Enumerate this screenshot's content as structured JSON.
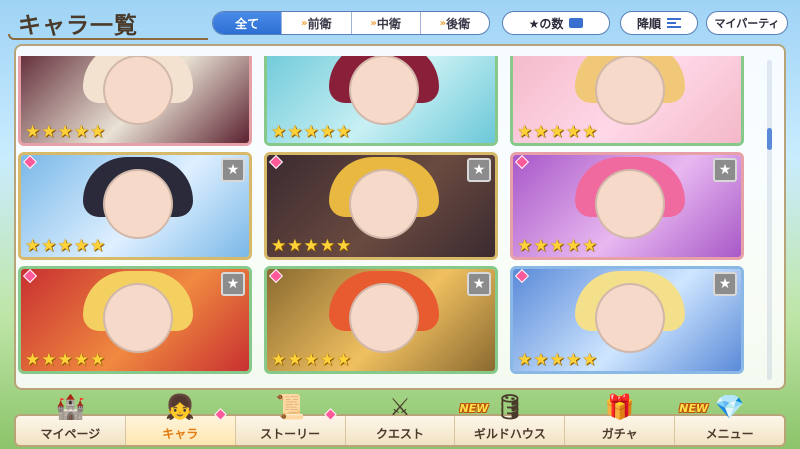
{
  "header": {
    "title": "キャラ一覧",
    "filters": [
      {
        "label": "全て",
        "active": true,
        "chevrons": ""
      },
      {
        "label": "前衛",
        "active": false,
        "chevrons": "»"
      },
      {
        "label": "中衛",
        "active": false,
        "chevrons": "»"
      },
      {
        "label": "後衛",
        "active": false,
        "chevrons": "»"
      }
    ],
    "sort_label": "★の数",
    "order_label": "降順",
    "party_label": "マイパーティ"
  },
  "cards": [
    {
      "stars": 5,
      "frame": "pink",
      "art": [
        "#5a2230",
        "#f3e2d0",
        "#e9e2d4"
      ],
      "rank": false,
      "new": false
    },
    {
      "stars": 5,
      "frame": "green",
      "art": [
        "#6bc8d8",
        "#8a1f3a",
        "#c8f0f4"
      ],
      "rank": false,
      "new": false
    },
    {
      "stars": 5,
      "frame": "green",
      "art": [
        "#f3b8c8",
        "#f0c878",
        "#ffd8e8"
      ],
      "rank": false,
      "new": false
    },
    {
      "stars": 5,
      "frame": "gold",
      "art": [
        "#7ab8e8",
        "#2a2a3a",
        "#dff0ff"
      ],
      "rank": true,
      "new": true
    },
    {
      "stars": 5,
      "frame": "gold",
      "art": [
        "#3a2a30",
        "#e8b840",
        "#6a4a40"
      ],
      "rank": true,
      "new": true
    },
    {
      "stars": 5,
      "frame": "pink",
      "art": [
        "#a858c8",
        "#f06aa0",
        "#e8b8f0"
      ],
      "rank": true,
      "new": true
    },
    {
      "stars": 5,
      "frame": "green",
      "art": [
        "#c83030",
        "#f4d060",
        "#f08a40"
      ],
      "rank": true,
      "new": true
    },
    {
      "stars": 5,
      "frame": "green",
      "art": [
        "#8a6a30",
        "#e85a30",
        "#f0c060"
      ],
      "rank": true,
      "new": true
    },
    {
      "stars": 5,
      "frame": "blue",
      "art": [
        "#5a8ad8",
        "#f4e08a",
        "#cfe6ff"
      ],
      "rank": true,
      "new": true
    }
  ],
  "star_glyph": "★",
  "rank_glyph": "★",
  "nav": [
    {
      "label": "マイページ",
      "icon": "castle-icon",
      "glyph": "🏰",
      "active": false,
      "new": false,
      "dot": false
    },
    {
      "label": "キャラ",
      "icon": "character-icon",
      "glyph": "👧",
      "active": true,
      "new": false,
      "dot": true
    },
    {
      "label": "ストーリー",
      "icon": "scroll-icon",
      "glyph": "📜",
      "active": false,
      "new": false,
      "dot": true
    },
    {
      "label": "クエスト",
      "icon": "sword-shield-icon",
      "glyph": "⚔",
      "active": false,
      "new": false,
      "dot": false
    },
    {
      "label": "ギルドハウス",
      "icon": "guild-house-icon",
      "glyph": "🛢",
      "active": false,
      "new": true,
      "dot": false
    },
    {
      "label": "ガチャ",
      "icon": "gacha-icon",
      "glyph": "🎁",
      "active": false,
      "new": false,
      "dot": false
    },
    {
      "label": "メニュー",
      "icon": "crystal-icon",
      "glyph": "💎",
      "active": false,
      "new": true,
      "dot": false
    }
  ],
  "new_badge_text": "NEW"
}
